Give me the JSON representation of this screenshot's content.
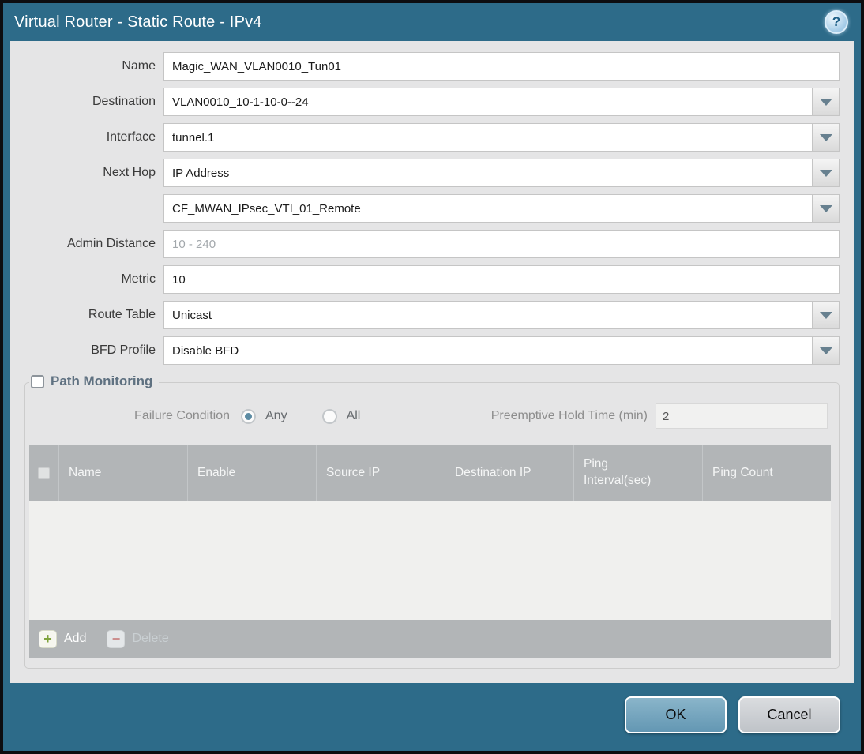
{
  "dialog": {
    "title": "Virtual Router - Static Route - IPv4",
    "help_icon": "help-icon",
    "help_glyph": "?"
  },
  "form": {
    "fields": [
      {
        "label": "Name",
        "value": "Magic_WAN_VLAN0010_Tun01",
        "has_dropdown": false
      },
      {
        "label": "Destination",
        "value": "VLAN0010_10-1-10-0--24",
        "has_dropdown": true
      },
      {
        "label": "Interface",
        "value": "tunnel.1",
        "has_dropdown": true
      },
      {
        "label": "Next Hop",
        "value": "IP Address",
        "has_dropdown": true
      },
      {
        "label": "",
        "value": "CF_MWAN_IPsec_VTI_01_Remote",
        "has_dropdown": true
      },
      {
        "label": "Admin Distance",
        "value": "",
        "placeholder": "10 - 240",
        "has_dropdown": false
      },
      {
        "label": "Metric",
        "value": "10",
        "has_dropdown": false
      },
      {
        "label": "Route Table",
        "value": "Unicast",
        "has_dropdown": true
      },
      {
        "label": "BFD Profile",
        "value": "Disable BFD",
        "has_dropdown": true
      }
    ]
  },
  "path_monitoring": {
    "legend": "Path Monitoring",
    "checkbox_checked": false,
    "failure_condition": {
      "label": "Failure Condition",
      "options": [
        {
          "label": "Any",
          "selected": true
        },
        {
          "label": "All",
          "selected": false
        }
      ]
    },
    "preemptive_hold_time": {
      "label": "Preemptive Hold Time (min)",
      "value": "2"
    },
    "table": {
      "columns": [
        "Name",
        "Enable",
        "Source IP",
        "Destination IP",
        "Ping Interval(sec)",
        "Ping Count"
      ],
      "rows": []
    },
    "actions": {
      "add_label": "Add",
      "add_glyph": "+",
      "delete_label": "Delete",
      "delete_glyph": "−"
    }
  },
  "footer": {
    "ok_label": "OK",
    "cancel_label": "Cancel"
  },
  "colors": {
    "frame_teal": "#2D6B89",
    "body_gray": "#E5E5E6",
    "table_header_gray": "#B2B5B7",
    "ok_button_blue": "#6397B3",
    "cancel_button_gray": "#C0C4C9",
    "radio_selected_teal": "#5C8BA3",
    "add_icon_green": "#7FA33C",
    "delete_icon_red": "#CC8D8D",
    "disabled_label_gray": "#8D8D8D"
  }
}
